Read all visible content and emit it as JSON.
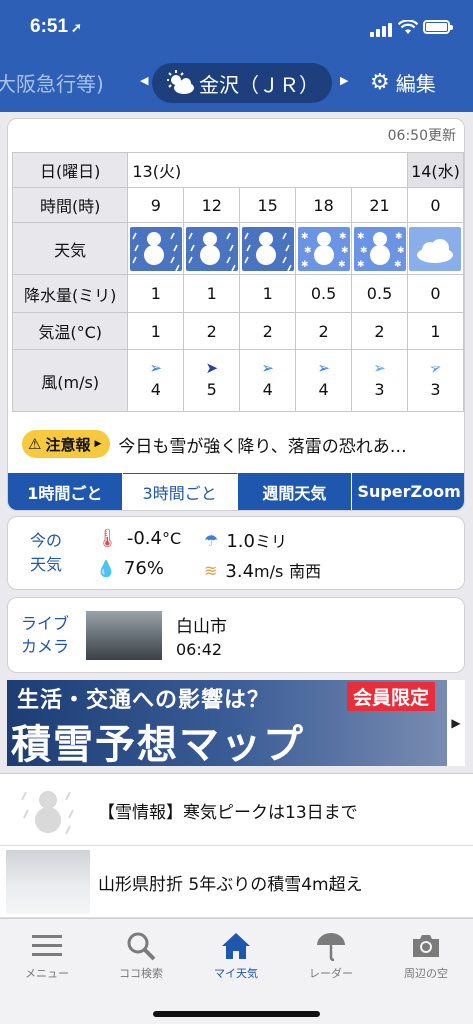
{
  "status_bar": {
    "time": "6:51",
    "location_arrow": "location-arrow-icon"
  },
  "location_nav": {
    "previous": "大阪急行等)",
    "current": "金沢（ＪＲ）",
    "edit_label": "編集"
  },
  "forecast": {
    "updated": "06:50更新",
    "labels": {
      "day": "日(曜日)",
      "time": "時間(時)",
      "weather": "天気",
      "precip": "降水量(ミリ)",
      "temp": "気温(°C)",
      "wind": "風(m/s)"
    },
    "days": [
      "13(火)",
      "14(水)"
    ],
    "columns": [
      {
        "hour": "9",
        "weather": "snow-heavy",
        "precip": "1",
        "temp": "1",
        "wind": "4",
        "wind_dir": "west"
      },
      {
        "hour": "12",
        "weather": "snow-heavy",
        "precip": "1",
        "temp": "2",
        "wind": "5",
        "wind_dir": "west"
      },
      {
        "hour": "15",
        "weather": "snow-heavy",
        "precip": "1",
        "temp": "2",
        "wind": "4",
        "wind_dir": "west"
      },
      {
        "hour": "18",
        "weather": "snow",
        "precip": "0.5",
        "temp": "2",
        "wind": "4",
        "wind_dir": "west"
      },
      {
        "hour": "21",
        "weather": "snow",
        "precip": "0.5",
        "temp": "2",
        "wind": "3",
        "wind_dir": "west"
      },
      {
        "hour": "0",
        "weather": "cloudy",
        "precip": "0",
        "temp": "1",
        "wind": "3",
        "wind_dir": "southwest"
      }
    ]
  },
  "alert": {
    "badge": "注意報",
    "text": "今日も雪が強く降り、落雷の恐れあ…"
  },
  "tabs": [
    "1時間ごと",
    "3時間ごと",
    "週間天気",
    "SuperZoom"
  ],
  "current": {
    "label_line1": "今の",
    "label_line2": "天気",
    "temp": "-0.4",
    "temp_unit": "°C",
    "precip": "1.0",
    "precip_unit": "ミリ",
    "humidity": "76%",
    "wind": "3.4",
    "wind_unit": "m/s",
    "wind_dir": "南西"
  },
  "camera": {
    "label_line1": "ライブ",
    "label_line2": "カメラ",
    "place": "白山市",
    "time": "06:42"
  },
  "banner": {
    "line1": "生活・交通への影響は？",
    "line2": "積雪予想マップ",
    "badge": "会員限定"
  },
  "news": [
    {
      "title": "【雪情報】寒気ピークは13日まで"
    },
    {
      "title": "山形県肘折 5年ぶりの積雪4m超え"
    }
  ],
  "bottom_nav": [
    {
      "label": "メニュー"
    },
    {
      "label": "ココ検索"
    },
    {
      "label": "マイ天気"
    },
    {
      "label": "レーダー"
    },
    {
      "label": "周辺の空"
    }
  ],
  "colors": {
    "header": "#2c5fb5",
    "accent": "#1e57ad",
    "alert": "#f6c93e",
    "member": "#e82e3a"
  }
}
